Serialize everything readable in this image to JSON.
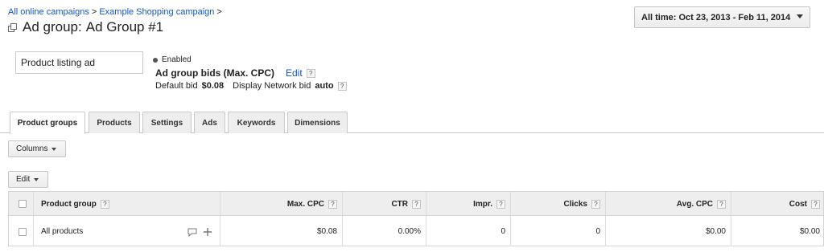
{
  "breadcrumb": {
    "items": [
      "All online campaigns",
      "Example Shopping campaign"
    ],
    "separator": ">"
  },
  "title": {
    "prefix": "Ad group:",
    "name": "Ad Group #1",
    "icon": "ad-group-icon"
  },
  "date_range": {
    "label": "All time: Oct 23, 2013 - Feb 11, 2014"
  },
  "ad_type": {
    "value": "Product listing ad"
  },
  "status": {
    "text": "Enabled"
  },
  "bids": {
    "title": "Ad group bids (Max. CPC)",
    "edit_label": "Edit",
    "help_glyph": "?",
    "default_bid_label": "Default bid",
    "default_bid_value": "$0.08",
    "display_network_label": "Display Network bid",
    "display_network_value": "auto"
  },
  "tabs": [
    {
      "label": "Product groups",
      "active": true
    },
    {
      "label": "Products",
      "active": false
    },
    {
      "label": "Settings",
      "active": false
    },
    {
      "label": "Ads",
      "active": false
    },
    {
      "label": "Keywords",
      "active": false
    },
    {
      "label": "Dimensions",
      "active": false
    }
  ],
  "toolbar": {
    "columns_label": "Columns",
    "edit_label": "Edit"
  },
  "table": {
    "headers": {
      "product_group": "Product group",
      "max_cpc": "Max. CPC",
      "ctr": "CTR",
      "impr": "Impr.",
      "clicks": "Clicks",
      "avg_cpc": "Avg. CPC",
      "cost": "Cost"
    },
    "rows": [
      {
        "product_group": "All products",
        "max_cpc": "$0.08",
        "ctr": "0.00%",
        "impr": "0",
        "clicks": "0",
        "avg_cpc": "$0.00",
        "cost": "$0.00"
      }
    ]
  },
  "colors": {
    "link": "#1155cc",
    "tab_bg": "#eeeeee",
    "header_bg": "#eeeeee",
    "border": "#c9c9c9"
  }
}
